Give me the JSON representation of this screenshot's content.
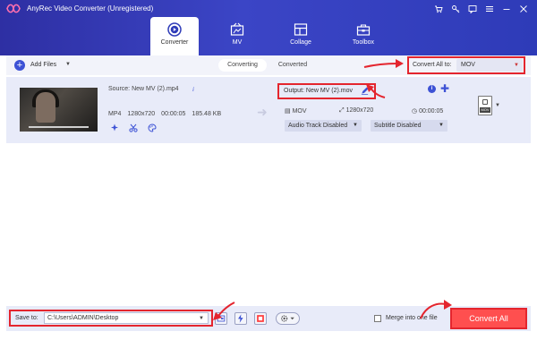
{
  "app": {
    "title": "AnyRec Video Converter (Unregistered)",
    "brand_color": "#2e3bb8",
    "accent_color": "#e4252e"
  },
  "window_controls": [
    {
      "icon": "cart-icon"
    },
    {
      "icon": "key-icon"
    },
    {
      "icon": "feedback-icon"
    },
    {
      "icon": "menu-icon"
    },
    {
      "icon": "minimize-icon"
    },
    {
      "icon": "close-icon"
    }
  ],
  "nav": {
    "tabs": [
      {
        "label": "Converter",
        "icon": "converter-icon",
        "active": true
      },
      {
        "label": "MV",
        "icon": "mv-icon",
        "active": false
      },
      {
        "label": "Collage",
        "icon": "collage-icon",
        "active": false
      },
      {
        "label": "Toolbox",
        "icon": "toolbox-icon",
        "active": false
      }
    ]
  },
  "toolbar": {
    "add_files_label": "Add Files",
    "segments": [
      "Converting",
      "Converted"
    ],
    "convert_all_label": "Convert All to:",
    "convert_all_value": "MOV"
  },
  "file": {
    "source_label": "Source: New MV (2).mp4",
    "format": "MP4",
    "resolution": "1280x720",
    "duration": "00:00:05",
    "size": "185.48 KB",
    "output_label": "Output: New MV (2).mov",
    "output_format": "MOV",
    "output_resolution": "1280x720",
    "output_duration": "00:00:05",
    "audio_track": "Audio Track Disabled",
    "subtitle": "Subtitle Disabled",
    "format_badge": "MOV"
  },
  "bottom": {
    "save_to_label": "Save to:",
    "save_path": "C:\\Users\\ADMIN\\Desktop",
    "merge_label": "Merge into one file",
    "convert_all_button": "Convert All"
  }
}
